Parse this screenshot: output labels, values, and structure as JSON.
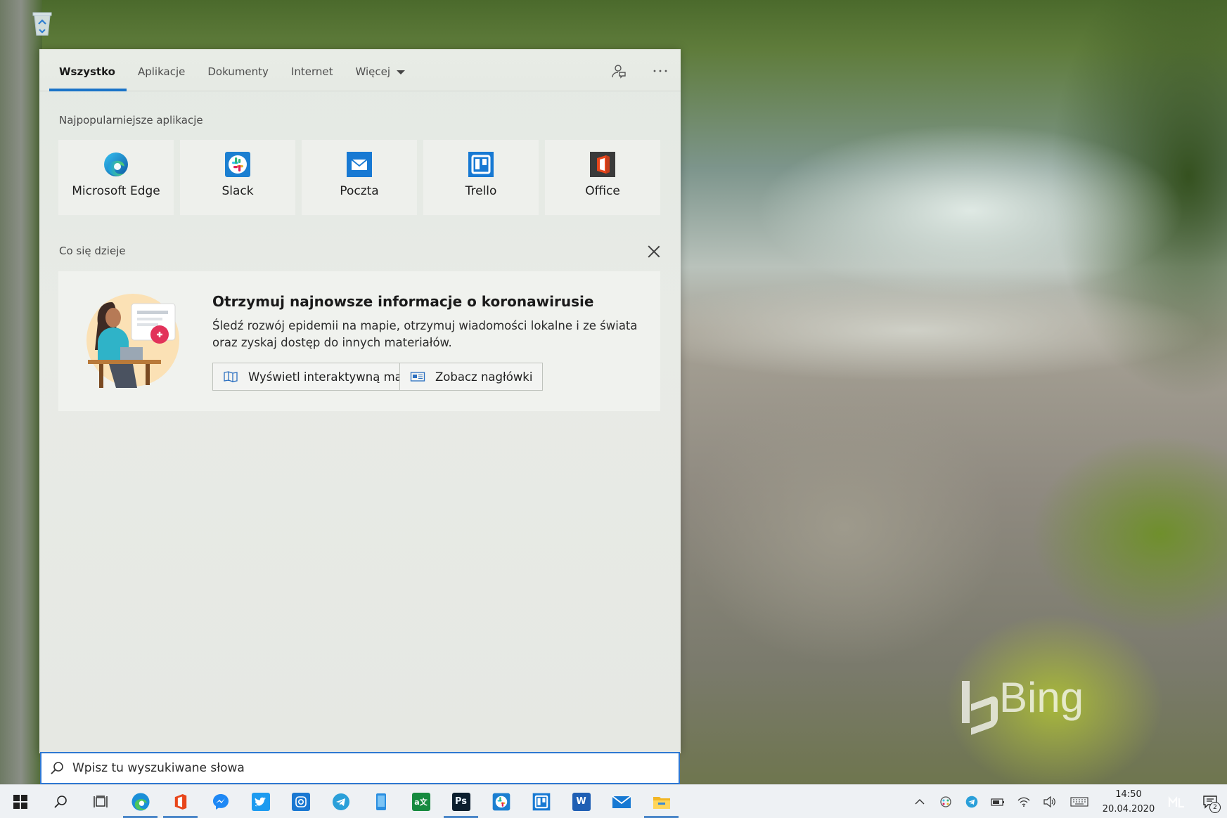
{
  "desktop": {
    "recycle_bin_icon": "recycle-bin-icon",
    "bing_watermark": "Bing"
  },
  "search_panel": {
    "tabs": [
      {
        "label": "Wszystko",
        "active": true
      },
      {
        "label": "Aplikacje"
      },
      {
        "label": "Dokumenty"
      },
      {
        "label": "Internet"
      },
      {
        "label": "Więcej"
      }
    ],
    "top_apps_heading": "Najpopularniejsze aplikacje",
    "top_apps": [
      {
        "label": "Microsoft Edge",
        "icon": "edge-icon"
      },
      {
        "label": "Slack",
        "icon": "slack-icon"
      },
      {
        "label": "Poczta",
        "icon": "mail-icon"
      },
      {
        "label": "Trello",
        "icon": "trello-icon"
      },
      {
        "label": "Office",
        "icon": "office-icon"
      }
    ],
    "news_heading": "Co się dzieje",
    "news_card": {
      "title": "Otrzymuj najnowsze informacje o koronawirusie",
      "text": "Śledź rozwój epidemii na mapie, otrzymuj wiadomości lokalne i ze świata oraz zyskaj dostęp do innych materiałów.",
      "button_map": "Wyświetl interaktywną mapę",
      "button_headlines": "Zobacz nagłówki"
    },
    "search_placeholder": "Wpisz tu wyszukiwane słowa"
  },
  "taskbar": {
    "apps": [
      "start-icon",
      "search-icon",
      "task-view-icon",
      "edge-icon",
      "office-icon",
      "messenger-icon",
      "twitter-icon",
      "instagram-icon",
      "telegram-icon",
      "phone-icon",
      "translator-icon",
      "photoshop-icon",
      "slack-icon",
      "trello-icon",
      "word-icon",
      "mail-icon",
      "file-explorer-icon"
    ],
    "tray": {
      "time": "14:50",
      "date": "20.04.2020",
      "notifications_count": "2"
    }
  },
  "colors": {
    "accent": "#1a73c8",
    "search_border": "#2e78d2",
    "taskbar_bg": "#eef1f4"
  }
}
